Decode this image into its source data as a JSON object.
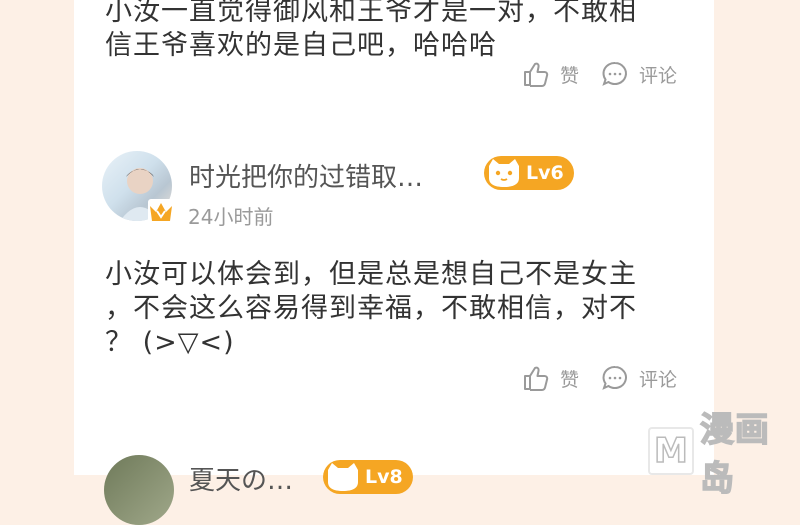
{
  "colors": {
    "page_bg": "#fdf0e6",
    "card_bg": "#ffffff",
    "level_badge": "#f5a623",
    "vip_crown": "#f5a623"
  },
  "comments": [
    {
      "text_lines": [
        "小汝一直觉得御风和王爷才是一对，不敢相",
        "信王爷喜欢的是自己吧，哈哈哈"
      ],
      "like_label": "赞",
      "reply_label": "评论"
    },
    {
      "username": "时光把你的过错取…",
      "level": "Lv6",
      "time": "24小时前",
      "text_lines": [
        "小汝可以体会到，但是总是想自己不是女主",
        "，不会这么容易得到幸福，不敢相信，对不",
        "？ (>▽<)"
      ],
      "like_label": "赞",
      "reply_label": "评论"
    },
    {
      "username": "夏天の…",
      "level": "Lv8"
    }
  ],
  "watermark": {
    "logo_letter": "M",
    "text": "漫画岛"
  },
  "icons": {
    "like": "thumbs-up-icon",
    "comment": "speech-bubble-icon",
    "vip": "crown-icon",
    "level": "cat-face-icon"
  }
}
